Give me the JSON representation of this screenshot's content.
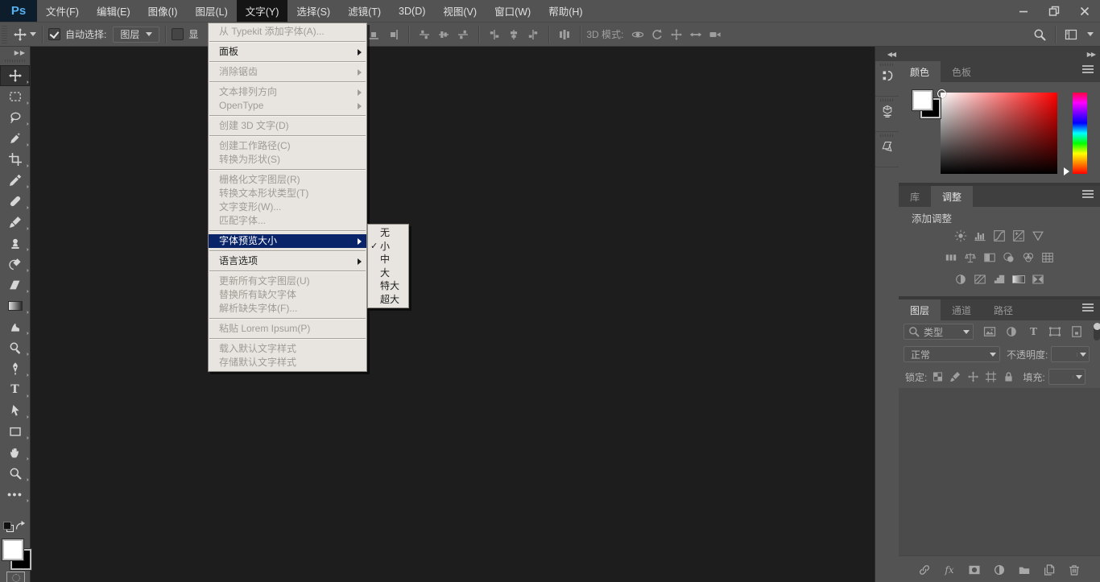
{
  "colors": {
    "chrome": "#535353",
    "chrome_dark": "#3f3f3f",
    "canvas": "#1d1d1d",
    "menu_bg": "#e8e5e0",
    "menu_highlight": "#0a246a",
    "logo_blue": "#54b2f2",
    "foreground_swatch": "#ffffff",
    "background_swatch": "#000000"
  },
  "menubar": {
    "logo": "Ps",
    "items": [
      {
        "key": "file",
        "label": "文件(F)",
        "selected": false
      },
      {
        "key": "edit",
        "label": "编辑(E)",
        "selected": false
      },
      {
        "key": "image",
        "label": "图像(I)",
        "selected": false
      },
      {
        "key": "layer",
        "label": "图层(L)",
        "selected": false
      },
      {
        "key": "type",
        "label": "文字(Y)",
        "selected": true
      },
      {
        "key": "select",
        "label": "选择(S)",
        "selected": false
      },
      {
        "key": "filter",
        "label": "滤镜(T)",
        "selected": false
      },
      {
        "key": "3d",
        "label": "3D(D)",
        "selected": false
      },
      {
        "key": "view",
        "label": "视图(V)",
        "selected": false
      },
      {
        "key": "window",
        "label": "窗口(W)",
        "selected": false
      },
      {
        "key": "help",
        "label": "帮助(H)",
        "selected": false
      }
    ]
  },
  "window_controls": [
    {
      "key": "minimize"
    },
    {
      "key": "restore"
    },
    {
      "key": "close"
    }
  ],
  "options_bar": {
    "tool_icon": "move",
    "auto_select_label": "自动选择:",
    "auto_select_checked": true,
    "target_value": "图层",
    "show_transform_label": "显",
    "show_transform_checked": false,
    "align_groups": [
      [
        "align-bottom-edges",
        "align-right-edges"
      ],
      [
        "align-top-edges",
        "align-vertical-centers",
        "align-bottom2-edges"
      ],
      [
        "align-left-edges",
        "align-horizontal-centers",
        "align-right2-edges"
      ],
      [
        "distribute-spacing"
      ]
    ],
    "mode_3d_label": "3D 模式:",
    "mode_3d_icons": [
      "3d-orbit",
      "3d-roll",
      "3d-pan",
      "3d-slide",
      "3d-zoom"
    ],
    "right_icons": [
      "search",
      "workspace"
    ]
  },
  "toolbar": {
    "tools": [
      {
        "key": "move",
        "selected": true
      },
      {
        "key": "rectangular-marquee",
        "selected": false
      },
      {
        "key": "lasso",
        "selected": false
      },
      {
        "key": "quick-selection",
        "selected": false
      },
      {
        "key": "crop",
        "selected": false
      },
      {
        "key": "eyedropper",
        "selected": false
      },
      {
        "key": "spot-healing-brush",
        "selected": false
      },
      {
        "key": "brush",
        "selected": false
      },
      {
        "key": "clone-stamp",
        "selected": false
      },
      {
        "key": "history-brush",
        "selected": false
      },
      {
        "key": "eraser",
        "selected": false
      },
      {
        "key": "gradient",
        "selected": false
      },
      {
        "key": "smudge",
        "selected": false
      },
      {
        "key": "dodge",
        "selected": false
      },
      {
        "key": "pen",
        "selected": false
      },
      {
        "key": "type",
        "selected": false
      },
      {
        "key": "path-selection",
        "selected": false
      },
      {
        "key": "rectangle-shape",
        "selected": false
      },
      {
        "key": "hand",
        "selected": false
      },
      {
        "key": "zoom",
        "selected": false
      },
      {
        "key": "more-tools",
        "selected": false
      }
    ],
    "foreground": "#ffffff",
    "background": "#000000"
  },
  "type_menu": {
    "items": [
      {
        "label": "从 Typekit 添加字体(A)...",
        "disabled": true,
        "submenu": false,
        "highlighted": false
      },
      {
        "sep": true
      },
      {
        "label": "面板",
        "disabled": false,
        "submenu": true,
        "highlighted": false
      },
      {
        "sep": true
      },
      {
        "label": "消除锯齿",
        "disabled": true,
        "submenu": true,
        "highlighted": false
      },
      {
        "sep": true
      },
      {
        "label": "文本排列方向",
        "disabled": true,
        "submenu": true,
        "highlighted": false
      },
      {
        "label": "OpenType",
        "disabled": true,
        "submenu": true,
        "highlighted": false
      },
      {
        "sep": true
      },
      {
        "label": "创建 3D 文字(D)",
        "disabled": true,
        "submenu": false,
        "highlighted": false
      },
      {
        "sep": true
      },
      {
        "label": "创建工作路径(C)",
        "disabled": true,
        "submenu": false,
        "highlighted": false
      },
      {
        "label": "转换为形状(S)",
        "disabled": true,
        "submenu": false,
        "highlighted": false
      },
      {
        "sep": true
      },
      {
        "label": "栅格化文字图层(R)",
        "disabled": true,
        "submenu": false,
        "highlighted": false
      },
      {
        "label": "转换文本形状类型(T)",
        "disabled": true,
        "submenu": false,
        "highlighted": false
      },
      {
        "label": "文字变形(W)...",
        "disabled": true,
        "submenu": false,
        "highlighted": false
      },
      {
        "label": "匹配字体...",
        "disabled": true,
        "submenu": false,
        "highlighted": false
      },
      {
        "sep": true
      },
      {
        "label": "字体预览大小",
        "disabled": false,
        "submenu": true,
        "highlighted": true
      },
      {
        "sep": true
      },
      {
        "label": "语言选项",
        "disabled": false,
        "submenu": true,
        "highlighted": false
      },
      {
        "sep": true
      },
      {
        "label": "更新所有文字图层(U)",
        "disabled": true,
        "submenu": false,
        "highlighted": false
      },
      {
        "label": "替换所有缺欠字体",
        "disabled": true,
        "submenu": false,
        "highlighted": false
      },
      {
        "label": "解析缺失字体(F)...",
        "disabled": true,
        "submenu": false,
        "highlighted": false
      },
      {
        "sep": true
      },
      {
        "label": "粘贴 Lorem Ipsum(P)",
        "disabled": true,
        "submenu": false,
        "highlighted": false
      },
      {
        "sep": true
      },
      {
        "label": "载入默认文字样式",
        "disabled": true,
        "submenu": false,
        "highlighted": false
      },
      {
        "label": "存储默认文字样式",
        "disabled": true,
        "submenu": false,
        "highlighted": false
      }
    ]
  },
  "font_preview_submenu": {
    "items": [
      {
        "label": "无",
        "checked": false
      },
      {
        "label": "小",
        "checked": true
      },
      {
        "label": "中",
        "checked": false
      },
      {
        "label": "大",
        "checked": false
      },
      {
        "label": "特大",
        "checked": false
      },
      {
        "label": "超大",
        "checked": false
      }
    ]
  },
  "dock_strip": {
    "icons": [
      {
        "key": "history"
      },
      {
        "key": "3d"
      },
      {
        "key": "layer-comps"
      }
    ]
  },
  "panels": {
    "color": {
      "tabs": [
        {
          "label": "颜色",
          "active": true
        },
        {
          "label": "色板",
          "active": false
        }
      ]
    },
    "adjustments": {
      "tabs": [
        {
          "label": "库",
          "active": false
        },
        {
          "label": "调整",
          "active": true
        }
      ],
      "header": "添加调整",
      "icon_rows": [
        [
          "brightness-contrast",
          "levels",
          "curves",
          "exposure",
          "vibrance"
        ],
        [
          "hue-saturation",
          "color-balance",
          "black-white",
          "photo-filter",
          "channel-mixer",
          "color-lookup"
        ],
        [
          "invert",
          "posterize",
          "threshold",
          "gradient-map",
          "selective-color"
        ]
      ]
    },
    "layers": {
      "tabs": [
        {
          "label": "图层",
          "active": true
        },
        {
          "label": "通道",
          "active": false
        },
        {
          "label": "路径",
          "active": false
        }
      ],
      "filter_label": "类型",
      "filter_icons": [
        "pixel-layers",
        "adjustment-layers",
        "type-layers",
        "shape-layers",
        "smart-objects"
      ],
      "blend_mode": "正常",
      "opacity_label": "不透明度:",
      "opacity_value": "",
      "lock_label": "锁定:",
      "lock_icons": [
        "lock-transparent",
        "lock-image",
        "lock-position",
        "lock-artboard",
        "lock-all"
      ],
      "fill_label": "填充:",
      "fill_value": "",
      "bottom_icons": [
        "link-layers",
        "layer-styles",
        "layer-mask",
        "new-adjustment-layer",
        "new-group",
        "new-layer",
        "delete-layer"
      ]
    }
  }
}
